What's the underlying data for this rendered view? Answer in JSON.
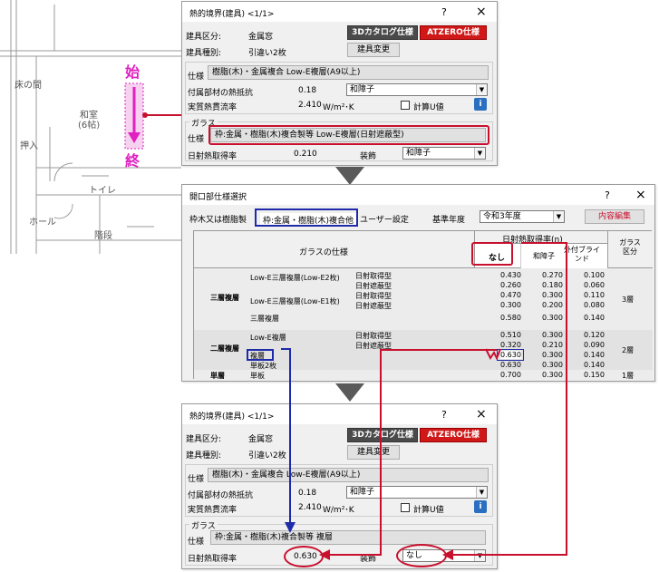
{
  "plan": {
    "rooms": [
      "床の間",
      "和室",
      "(6帖)",
      "押入",
      "トイレ",
      "ホール",
      "階段"
    ],
    "start_marker": "始",
    "end_marker": "終"
  },
  "dialog1": {
    "title": "熱的境界(建具) <1/1>",
    "help": "?",
    "close": "×",
    "cat_label": "建具区分:",
    "cat_value": "金属窓",
    "btn_3d": "3Dカタログ仕様",
    "btn_atzero": "ATZERO仕様",
    "kind_label": "建具種別:",
    "kind_value": "引違い2枚",
    "btn_change": "建具変更",
    "spec_label": "仕様",
    "spec_value": "樹脂(木)・金属複合 Low-E複層(A9以上)",
    "att_label": "付属部材の熱抵抗",
    "att_value": "0.18",
    "att_select": "和障子",
    "heat_label": "実質熱貫流率",
    "heat_value": "2.410",
    "heat_unit": "W/m²･K",
    "calc_u": "計算U値",
    "glass_group": "ガラス",
    "glass_spec_label": "仕様",
    "glass_spec_value": "枠:金属・樹脂(木)複合製等 Low-E複層(日射遮蔽型)",
    "solar_label": "日射熱取得率",
    "solar_value": "0.210",
    "deco_label": "装飾",
    "deco_value": "和障子",
    "info_icon": "i"
  },
  "dialog2": {
    "title": "開口部仕様選択",
    "help": "?",
    "close": "×",
    "tabs": [
      "枠木又は樹脂製",
      "枠:金属・樹脂(木)複合他",
      "ユーザー設定"
    ],
    "year_label": "基準年度",
    "year_value": "令和3年度",
    "edit_btn": "内容編集",
    "head_glass": "ガラスの仕様",
    "head_solar": "日射熱取得率(η)",
    "head_none": "なし",
    "head_shoji": "和障子",
    "head_blind": "外付ブラインド",
    "head_class": "ガラス区分",
    "rows": [
      {
        "g1": "三層複層",
        "g2": "Low-E三層複層(Low-E2枚)",
        "g3": "日射取得型",
        "v1": "0.430",
        "v2": "0.270",
        "v3": "0.100",
        "c": "3層"
      },
      {
        "g1": "",
        "g2": "",
        "g3": "日射遮蔽型",
        "v1": "0.260",
        "v2": "0.180",
        "v3": "0.060",
        "c": ""
      },
      {
        "g1": "",
        "g2": "Low-E三層複層(Low-E1枚)",
        "g3": "日射取得型",
        "v1": "0.470",
        "v2": "0.300",
        "v3": "0.110",
        "c": ""
      },
      {
        "g1": "",
        "g2": "",
        "g3": "日射遮蔽型",
        "v1": "0.300",
        "v2": "0.200",
        "v3": "0.080",
        "c": ""
      },
      {
        "g1": "",
        "g2": "三層複層",
        "g3": "",
        "v1": "0.580",
        "v2": "0.300",
        "v3": "0.140",
        "c": ""
      },
      {
        "g1": "二層複層",
        "g2": "Low-E複層",
        "g3": "日射取得型",
        "v1": "0.510",
        "v2": "0.300",
        "v3": "0.120",
        "c": "2層"
      },
      {
        "g1": "",
        "g2": "",
        "g3": "日射遮蔽型",
        "v1": "0.320",
        "v2": "0.210",
        "v3": "0.090",
        "c": ""
      },
      {
        "g1": "",
        "g2": "複層",
        "g3": "",
        "v1": "0.630",
        "v2": "0.300",
        "v3": "0.140",
        "c": ""
      },
      {
        "g1": "",
        "g2": "単板2枚",
        "g3": "",
        "v1": "0.630",
        "v2": "0.300",
        "v3": "0.140",
        "c": ""
      },
      {
        "g1": "単層",
        "g2": "単板",
        "g3": "",
        "v1": "0.700",
        "v2": "0.300",
        "v3": "0.150",
        "c": "1層"
      }
    ]
  },
  "dialog3": {
    "title": "熱的境界(建具) <1/1>",
    "help": "?",
    "close": "×",
    "cat_label": "建具区分:",
    "cat_value": "金属窓",
    "btn_3d": "3Dカタログ仕様",
    "btn_atzero": "ATZERO仕様",
    "kind_label": "建具種別:",
    "kind_value": "引違い2枚",
    "btn_change": "建具変更",
    "spec_label": "仕様",
    "spec_value": "樹脂(木)・金属複合 Low-E複層(A9以上)",
    "att_label": "付属部材の熱抵抗",
    "att_value": "0.18",
    "att_select": "和障子",
    "heat_label": "実質熱貫流率",
    "heat_value": "2.410",
    "heat_unit": "W/m²･K",
    "calc_u": "計算U値",
    "glass_group": "ガラス",
    "glass_spec_label": "仕様",
    "glass_spec_value": "枠:金属・樹脂(木)複合製等 複層",
    "solar_label": "日射熱取得率",
    "solar_value": "0.630",
    "deco_label": "装飾",
    "deco_value": "なし",
    "info_icon": "i"
  },
  "colors": {
    "accent_red": "#c8102e",
    "accent_blue": "#1f2aa8",
    "marker": "#e020c0"
  }
}
